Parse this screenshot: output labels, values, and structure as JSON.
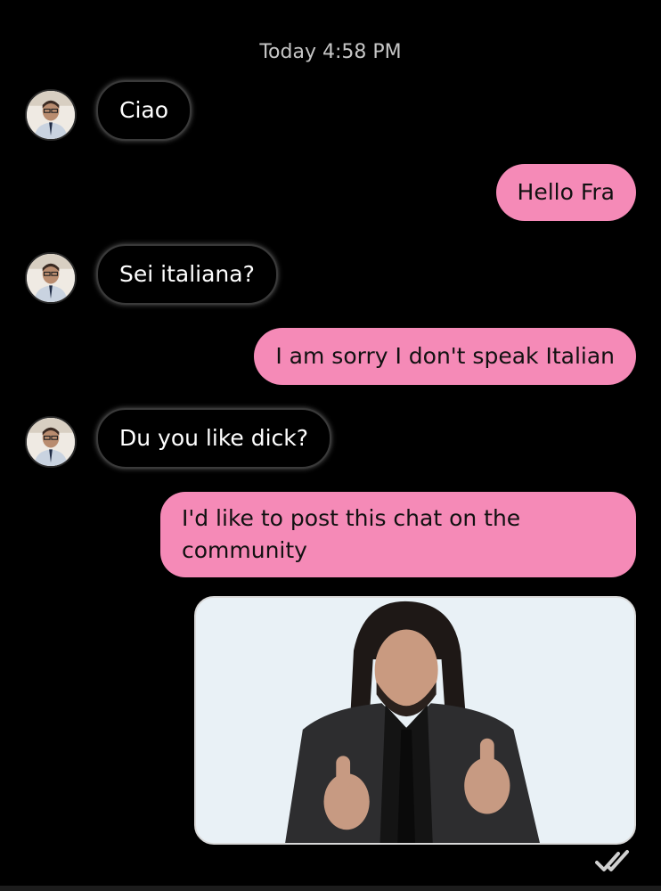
{
  "chat": {
    "timestamp": "Today 4:58 PM",
    "messages": [
      {
        "sender": "other",
        "text": "Ciao"
      },
      {
        "sender": "me",
        "text": "Hello Fra"
      },
      {
        "sender": "other",
        "text": "Sei italiana?"
      },
      {
        "sender": "me",
        "text": "I am sorry I don't speak Italian"
      },
      {
        "sender": "other",
        "text": "Du you like dick?"
      },
      {
        "sender": "me",
        "text": "I'd like to post this chat on the community"
      }
    ],
    "image_message": {
      "icon": "gif-image"
    },
    "read_receipt_icon": "double-check-icon"
  },
  "colors": {
    "background": "#000000",
    "outgoing_bubble": "#f58ab7",
    "incoming_bubble": "#000000",
    "timestamp_text": "#c6c6c6"
  }
}
